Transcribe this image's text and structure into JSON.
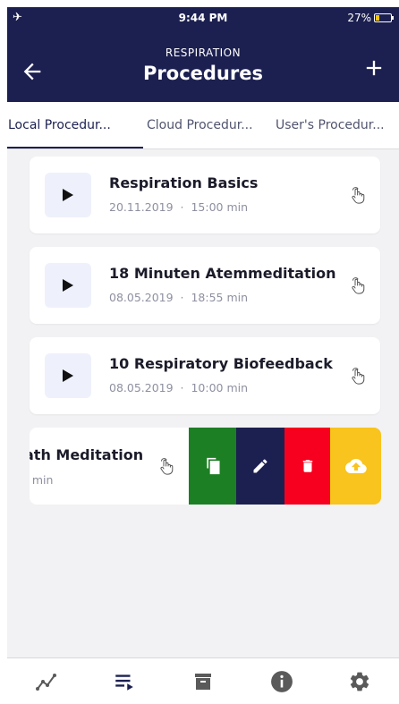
{
  "status_bar": {
    "time": "9:44 PM",
    "battery": "27%",
    "battery_level": 0.27
  },
  "header": {
    "subtitle": "RESPIRATION",
    "title": "Procedures"
  },
  "tabs": [
    {
      "label": "Local Procedur...",
      "active": true
    },
    {
      "label": "Cloud Procedur...",
      "active": false
    },
    {
      "label": "User's Procedur...",
      "active": false
    }
  ],
  "procedures": [
    {
      "title": "Respiration Basics",
      "date": "20.11.2019",
      "separator": "·",
      "duration": "15:00 min"
    },
    {
      "title": "18 Minuten Atemmeditation",
      "date": "08.05.2019",
      "separator": "·",
      "duration": "18:55 min"
    },
    {
      "title": "10 Respiratory Biofeedback",
      "date": "08.05.2019",
      "separator": "·",
      "duration": "10:00 min"
    }
  ],
  "swiped_item": {
    "title": "ath Meditation",
    "meta": ") min"
  },
  "swipe_actions": [
    "copy-icon",
    "edit-icon",
    "delete-icon",
    "upload-cloud-icon"
  ],
  "bottom_nav": [
    "chart-icon",
    "playlist-icon",
    "archive-icon",
    "info-icon",
    "settings-icon"
  ],
  "colors": {
    "primary": "#1c2050",
    "copy": "#1d7f24",
    "delete": "#f7001f",
    "upload": "#f8c41d",
    "play_bg": "#eef1fb"
  }
}
